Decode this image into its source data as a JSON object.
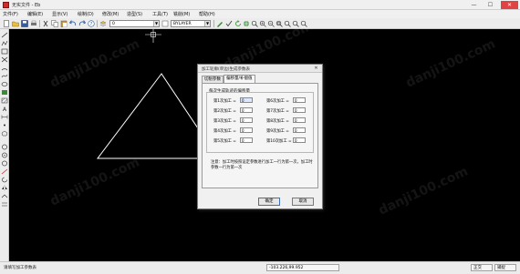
{
  "window": {
    "title": "无实文件 - Eb",
    "minimize": "—",
    "maximize": "☐",
    "close": "✕"
  },
  "menu": [
    "文件(F)",
    "编辑(E)",
    "显示(V)",
    "绘制(D)",
    "修改(M)",
    "造型(S)",
    "工具(T)",
    "铣削(M)",
    "帮助(H)"
  ],
  "toolbar": {
    "layer_combo": "0",
    "linetype_combo": "BYLAYER"
  },
  "dialog": {
    "title": "加工轮廓(单边)生成参数表",
    "close": "✕",
    "tabs": [
      "切削参数",
      "偏移量/补偿值"
    ],
    "active_tab": 1,
    "group_label": "每次生成轨迹的偏移量",
    "fields": [
      {
        "label": "第1次加工 =",
        "value": "0"
      },
      {
        "label": "第2次加工 =",
        "value": "0"
      },
      {
        "label": "第3次加工 =",
        "value": "0"
      },
      {
        "label": "第4次加工 =",
        "value": "0"
      },
      {
        "label": "第5次加工 =",
        "value": "0"
      },
      {
        "label": "第6次加工 =",
        "value": "0"
      },
      {
        "label": "第7次加工 =",
        "value": "0"
      },
      {
        "label": "第8次加工 =",
        "value": "0"
      },
      {
        "label": "第9次加工 =",
        "value": "0"
      },
      {
        "label": "第10次加工 =",
        "value": "0"
      }
    ],
    "note": "注意：加工时按照设定参数进行加工一行为第一次，加工时参数一行为第一次",
    "ok": "确定",
    "cancel": "取消"
  },
  "status": {
    "prompt": "请填写加工参数表",
    "coords": "-103.226,99.952",
    "mode": "正交",
    "ortho": "捕捉"
  },
  "watermark": "danji100.com"
}
